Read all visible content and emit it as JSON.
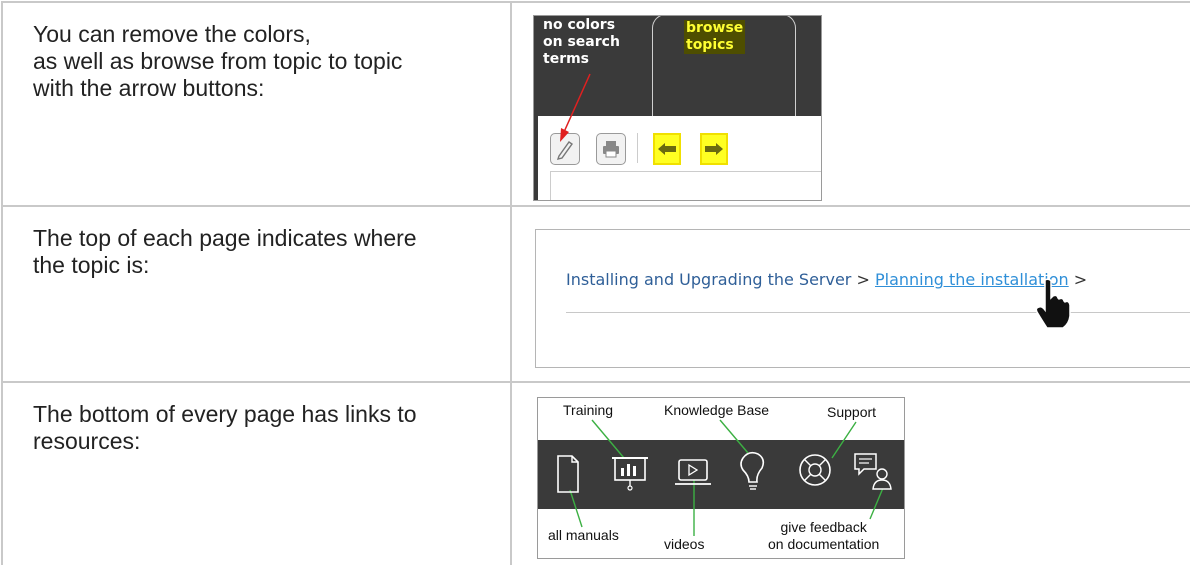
{
  "rows": [
    {
      "text": "You can remove the colors,\nas well as browse from topic to topic\nwith the arrow buttons:",
      "screenshot": {
        "label_no_colors": "no colors\non search\nterms",
        "label_browse": "browse\ntopics",
        "buttons": [
          {
            "name": "pencil",
            "icon": "pencil-icon"
          },
          {
            "name": "print",
            "icon": "printer-icon"
          },
          {
            "name": "previous",
            "icon": "arrow-left-icon",
            "highlight": "#ffff22"
          },
          {
            "name": "next",
            "icon": "arrow-right-icon",
            "highlight": "#ffff22"
          }
        ]
      }
    },
    {
      "text": "The top of each page indicates where\nthe topic is:",
      "screenshot": {
        "crumb_1": "Installing and Upgrading the Server",
        "separator": ">",
        "crumb_2": "Planning the installation",
        "separator_tail": ">"
      }
    },
    {
      "text": "The bottom of every page has links to\nresources:",
      "screenshot": {
        "top_labels": {
          "training": "Training",
          "knowledge_base": "Knowledge Base",
          "support": "Support"
        },
        "bottom_labels": {
          "all_manuals": "all manuals",
          "videos": "videos",
          "feedback": "give feedback\non documentation"
        },
        "icons": [
          "document-icon",
          "presentation-icon",
          "video-icon",
          "lightbulb-icon",
          "lifebuoy-icon",
          "feedback-icon"
        ]
      }
    }
  ],
  "colors": {
    "border": "#c9c9c9",
    "highlight_yellow": "#ffff22",
    "link_blue": "#2f8fd8",
    "callout_green": "#3cb043",
    "callout_red": "#e02020"
  }
}
